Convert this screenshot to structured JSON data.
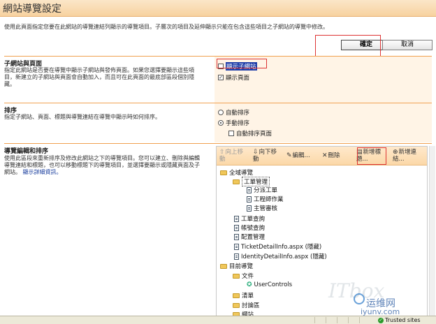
{
  "page_title": "網站導覽設定",
  "intro": "使用此頁面指定您要在此網站的導覽連結列顯示的導覽項目。子層次的項目及延伸顯示只能在包含這些項目之子網站的導覽中修改。",
  "buttons": {
    "ok": "確定",
    "cancel": "取消"
  },
  "sections": {
    "subsites": {
      "title": "子網站與頁面",
      "desc": "指定此網站是否要在導覽中顯示子網站與發佈頁面。如果您選擇要顯示這些項目，新建立的子網站與頁面會自動加入，而且可在此頁面的最底部區段個別隱藏。",
      "show_subsites": "顯示子網站",
      "show_pages": "顯示頁面"
    },
    "sorting": {
      "title": "排序",
      "desc": "指定子網站、頁面、標題與導覽連結在導覽中顯示時如何排序。",
      "auto_sort": "自動排序",
      "manual_sort": "手動排序",
      "auto_sort_pages": "自動排序頁面"
    },
    "nav_edit": {
      "title": "導覽編輯和排序",
      "desc": "使用此區段來重新排序及修改此網站之下的導覽項目。您可以建立、刪除與編輯導覽連結和標題，也可以移動標題下的導覽項目，並選擇要顯示或隱藏頁面及子網站。",
      "more_link": "顯示詳細資訊。"
    }
  },
  "toolbar": {
    "move_up": "向上移動",
    "move_down": "向下移動",
    "edit": "編輯...",
    "delete": "刪除",
    "add_heading": "新增標題...",
    "add_link": "新增連結..."
  },
  "tree": {
    "global_nav": "全域導覽",
    "work_order_mgmt": "工單管理",
    "dispatch": "分派工單",
    "engineer_work": "工程師作業",
    "supervisor_review": "主管審核",
    "work_order_query": "工單查詢",
    "account_query": "帳號查詢",
    "config_mgmt": "配置管理",
    "ticket_detail": "TicketDetailInfo.aspx (隱藏)",
    "identity_detail": "IdentityDetailInfo.aspx (隱藏)",
    "current_nav": "目前導覽",
    "documents": "文件",
    "user_controls": "UserControls",
    "lists": "清單",
    "discussions": "討論區",
    "sites": "網站"
  },
  "status": {
    "trusted": "Trusted sites"
  },
  "watermark": {
    "brand": "ITbox",
    "site_cn": "运维网",
    "site_url": "iyunv.com"
  }
}
